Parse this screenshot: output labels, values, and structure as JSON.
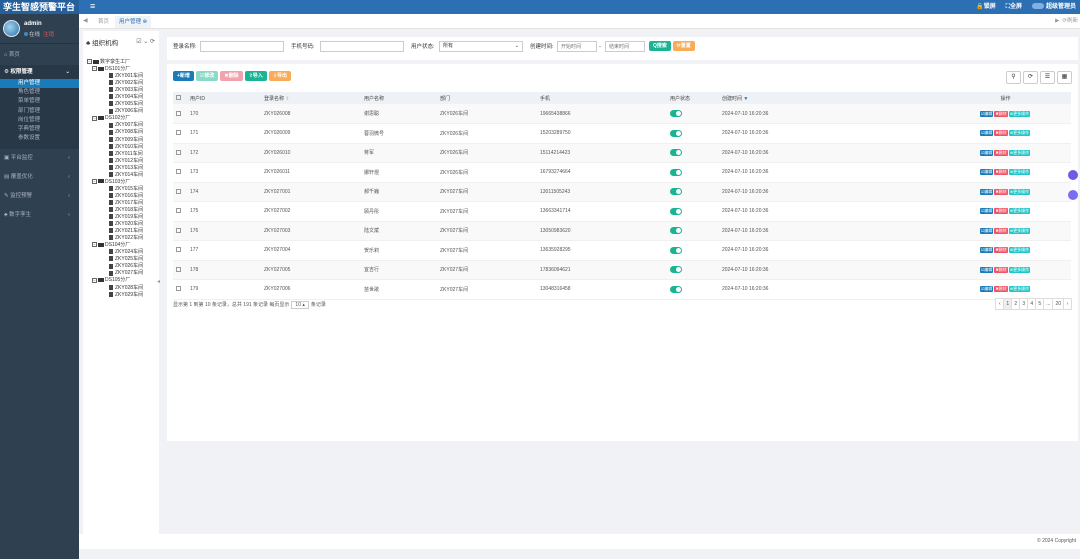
{
  "app": {
    "title": "孪生智感预警平台",
    "toggle_icon": "≡"
  },
  "header": {
    "lock": "🔒锁屏",
    "fullscreen": "⛶全屏",
    "user": "超级管理员"
  },
  "user": {
    "name": "admin",
    "status": "在线",
    "logout": "注销"
  },
  "sidebar": {
    "home": "首页",
    "groups": [
      {
        "label": "权限管理",
        "expanded": true,
        "items": [
          "用户管理",
          "角色管理",
          "菜单管理",
          "部门管理",
          "岗位管理",
          "字典管理",
          "参数设置"
        ]
      },
      {
        "label": "平台监控"
      },
      {
        "label": "覆盖优化"
      },
      {
        "label": "监控预警"
      },
      {
        "label": "数字孪生"
      }
    ]
  },
  "tabs": {
    "home": "首页",
    "current": "用户管理",
    "close": "⊗",
    "refresh": "刷新"
  },
  "tree": {
    "title": "组织机构",
    "root": "数字孪生工厂",
    "factories": [
      {
        "name": "DS101分厂",
        "workshops": [
          "ZKY001车间",
          "ZKY002车间",
          "ZKY003车间",
          "ZKY004车间",
          "ZKY005车间",
          "ZKY006车间"
        ]
      },
      {
        "name": "DS102分厂",
        "workshops": [
          "ZKY007车间",
          "ZKY008车间",
          "ZKY009车间",
          "ZKY010车间",
          "ZKY011车间",
          "ZKY012车间",
          "ZKY013车间",
          "ZKY014车间"
        ]
      },
      {
        "name": "DS103分厂",
        "workshops": [
          "ZKY015车间",
          "ZKY016车间",
          "ZKY017车间",
          "ZKY018车间",
          "ZKY019车间",
          "ZKY020车间",
          "ZKY021车间",
          "ZKY022车间"
        ]
      },
      {
        "name": "DS104分厂",
        "workshops": [
          "ZKY024车间",
          "ZKY025车间",
          "ZKY026车间",
          "ZKY027车间"
        ]
      },
      {
        "name": "DS105分厂",
        "workshops": [
          "ZKY028车间",
          "ZKY029车间"
        ]
      }
    ]
  },
  "search": {
    "login_label": "登录名称:",
    "phone_label": "手机号码:",
    "status_label": "用户状态:",
    "status_value": "所有",
    "created_label": "创建时间:",
    "start_placeholder": "开始时间",
    "end_placeholder": "结束时间",
    "search_btn": "Q搜索",
    "reset_btn": "⟳重置"
  },
  "toolbar": {
    "add": "+新增",
    "edit": "☑修改",
    "delete": "✖删除",
    "import": "⇧导入",
    "export": "⇩导出"
  },
  "table": {
    "columns": [
      "用户ID",
      "登录名称",
      "用户名称",
      "部门",
      "手机",
      "用户状态",
      "创建时间",
      "操作"
    ],
    "ops": {
      "edit": "☑编辑",
      "del": "✖删除",
      "more": "⊕更多操作"
    },
    "rows": [
      [
        "170",
        "ZKY026008",
        "谢思聪",
        "ZKY026车间",
        "19665438866",
        "2024-07-10 16:20:36"
      ],
      [
        "171",
        "ZKY026009",
        "蓉羽微号",
        "ZKY026车间",
        "15203289750",
        "2024-07-10 16:20:36"
      ],
      [
        "172",
        "ZKY026010",
        "蒋军",
        "ZKY026车间",
        "15114214423",
        "2024-07-10 16:20:36"
      ],
      [
        "173",
        "ZKY026011",
        "娜轩煜",
        "ZKY026车间",
        "16793274664",
        "2024-07-10 16:20:36"
      ],
      [
        "174",
        "ZKY027001",
        "郝千巍",
        "ZKY027车间",
        "13011505243",
        "2024-07-10 16:20:36"
      ],
      [
        "175",
        "ZKY027002",
        "顾丹彤",
        "ZKY027车间",
        "13663341714",
        "2024-07-10 16:20:36"
      ],
      [
        "176",
        "ZKY027003",
        "陆文斌",
        "ZKY027车间",
        "13050983620",
        "2024-07-10 16:20:36"
      ],
      [
        "177",
        "ZKY027004",
        "贺乐莉",
        "ZKY027车间",
        "13635928295",
        "2024-07-10 16:20:36"
      ],
      [
        "178",
        "ZKY027005",
        "宜吉行",
        "ZKY027车间",
        "17836094621",
        "2024-07-10 16:20:36"
      ],
      [
        "179",
        "ZKY027006",
        "苗世歌",
        "ZKY027车间",
        "13048316458",
        "2024-07-10 16:20:36"
      ]
    ]
  },
  "pagination": {
    "info_prefix": "显示第 1 到第 10 条记录，总共 191 条记录  每页显示",
    "page_size": "10 ▴",
    "info_suffix": "条记录",
    "pages": [
      "‹",
      "1",
      "2",
      "3",
      "4",
      "5",
      "...",
      "20",
      "›"
    ]
  },
  "footer": "© 2024 Copyright",
  "colors": {
    "primary": "#1a7bb9",
    "success": "#1ab394",
    "danger": "#ed5565",
    "warning": "#f8ac59",
    "info": "#23c6c8",
    "sidebar": "#2f4050"
  }
}
